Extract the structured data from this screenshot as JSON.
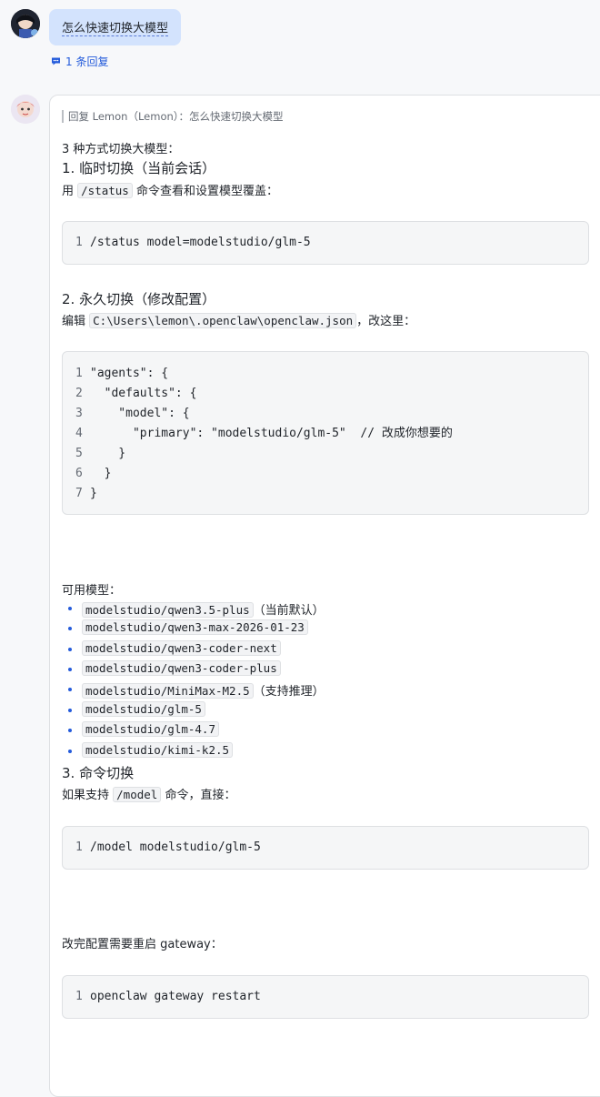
{
  "thread": {
    "question": "怎么快速切换大模型",
    "reply_count_label": "1 条回复"
  },
  "reply": {
    "quote": "回复 Lemon（Lemon）：怎么快速切换大模型",
    "intro": "3 种方式切换大模型：",
    "section1": {
      "heading": "1. 临时切换（当前会话）",
      "text_pre": "用",
      "inline_code": "/status",
      "text_post": "命令查看和设置模型覆盖：",
      "code_lines": [
        "/status model=modelstudio/glm-5"
      ]
    },
    "section2": {
      "heading": "2. 永久切换（修改配置）",
      "text_pre": "编辑",
      "inline_code": "C:\\Users\\lemon\\.openclaw\\openclaw.json",
      "text_post": "，改这里：",
      "code_lines": [
        "\"agents\": {",
        "  \"defaults\": {",
        "    \"model\": {",
        "      \"primary\": \"modelstudio/glm-5\"  // 改成你想要的",
        "    }",
        "  }",
        "}"
      ]
    },
    "models_heading": "可用模型：",
    "models": [
      {
        "code": "modelstudio/qwen3.5-plus",
        "note": "（当前默认）"
      },
      {
        "code": "modelstudio/qwen3-max-2026-01-23",
        "note": ""
      },
      {
        "code": "modelstudio/qwen3-coder-next",
        "note": ""
      },
      {
        "code": "modelstudio/qwen3-coder-plus",
        "note": ""
      },
      {
        "code": "modelstudio/MiniMax-M2.5",
        "note": "（支持推理）"
      },
      {
        "code": "modelstudio/glm-5",
        "note": ""
      },
      {
        "code": "modelstudio/glm-4.7",
        "note": ""
      },
      {
        "code": "modelstudio/kimi-k2.5",
        "note": ""
      }
    ],
    "section3": {
      "heading": "3. 命令切换",
      "text_pre": "如果支持",
      "inline_code": "/model",
      "text_post": "命令，直接：",
      "code_lines": [
        "/model modelstudio/glm-5"
      ]
    },
    "restart_text": "改完配置需要重启 gateway：",
    "restart_code_lines": [
      "openclaw gateway restart"
    ],
    "line_numbers": [
      "1",
      "2",
      "3",
      "4",
      "5",
      "6",
      "7"
    ]
  },
  "colors": {
    "accent": "#245bdb",
    "bubble": "#d3e3fd",
    "code_bg": "#f5f6f7"
  }
}
